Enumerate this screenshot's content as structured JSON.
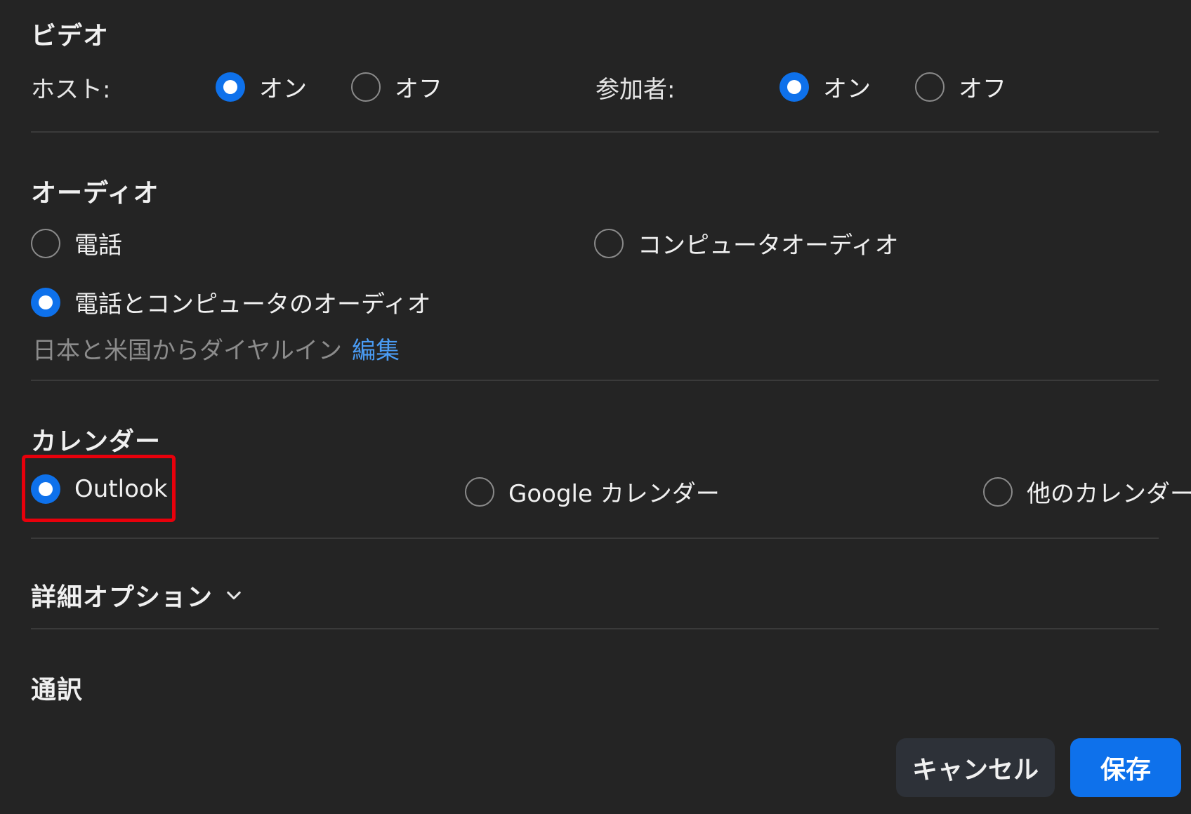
{
  "video": {
    "title": "ビデオ",
    "host_label": "ホスト:",
    "participant_label": "参加者:",
    "on": "オン",
    "off": "オフ",
    "host_selected": "on",
    "participant_selected": "on"
  },
  "audio": {
    "title": "オーディオ",
    "options": [
      "電話",
      "コンピュータオーディオ",
      "電話とコンピュータのオーディオ"
    ],
    "selected": "電話とコンピュータのオーディオ",
    "dial_in_text": "日本と米国からダイヤルイン",
    "edit_link": "編集"
  },
  "calendar": {
    "title": "カレンダー",
    "options": [
      "Outlook",
      "Google カレンダー",
      "他のカレンダー"
    ],
    "selected": "Outlook"
  },
  "advanced": {
    "title": "詳細オプション"
  },
  "interpretation": {
    "title": "通訳"
  },
  "buttons": {
    "cancel": "キャンセル",
    "save": "保存"
  },
  "colors": {
    "accent": "#0e71eb",
    "highlight": "#e8000b",
    "link": "#4a9cf5",
    "background": "#242424"
  }
}
